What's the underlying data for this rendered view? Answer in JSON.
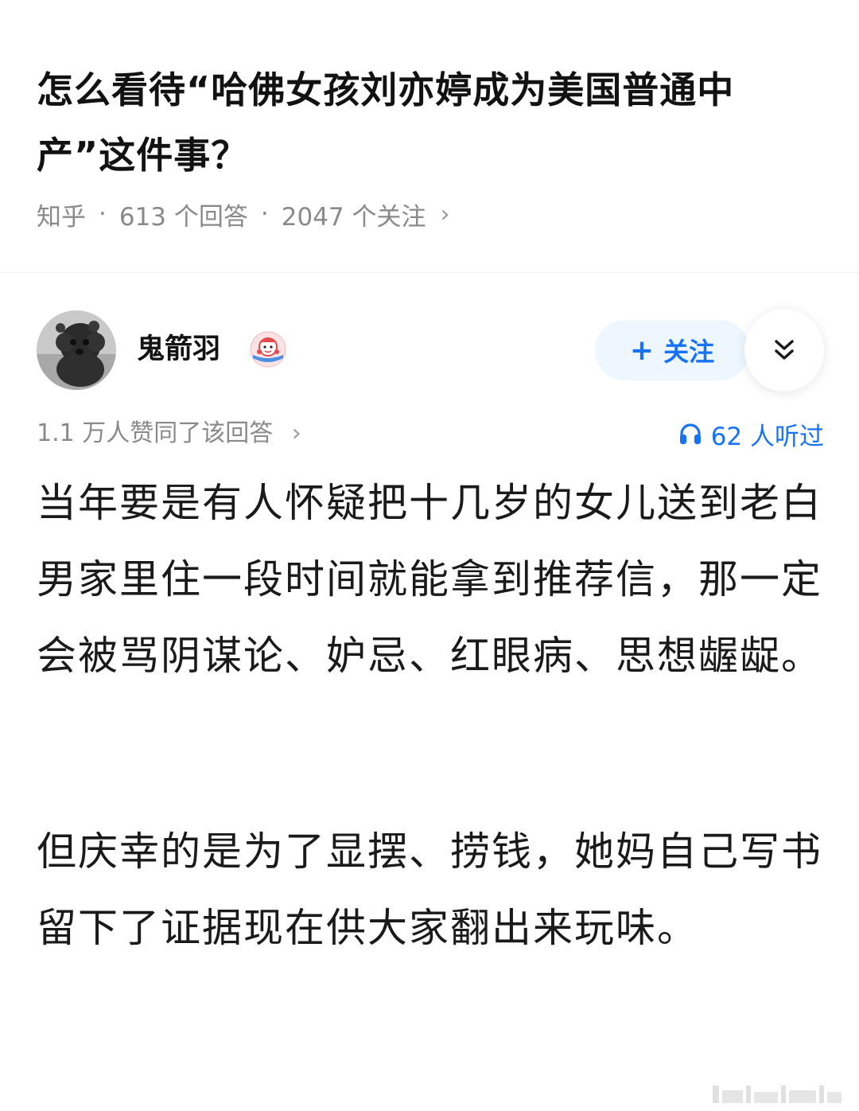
{
  "question": {
    "title": "怎么看待“哈佛女孩刘亦婷成为美国普通中产”这件事？",
    "source": "知乎",
    "separator": "·",
    "answers_count": "613 个回答",
    "followers_count": "2047 个关注",
    "chevron": "›"
  },
  "author": {
    "name": "鬼箭羽",
    "follow_plus": "+",
    "follow_label": "关注",
    "avatar_icon": "dog-avatar-icon",
    "badge_icon": "red-mascot-badge-icon",
    "more_icon": "double-chevron-down-icon"
  },
  "answer": {
    "upvotes": "1.1 万人赞同了该回答",
    "upvotes_chevron": "›",
    "listened": "62 人听过",
    "listened_icon": "headphones-icon",
    "paragraphs": [
      "当年要是有人怀疑把十几岁的女儿送到老白男家里住一段时间就能拿到推荐信，那一定会被骂阴谋论、妒忌、红眼病、思想龌龊。",
      "但庆幸的是为了显摆、捞钱，她妈自己写书留下了证据现在供大家翻出来玩味。"
    ]
  },
  "colors": {
    "accent": "#1772f6",
    "follow_bg": "#eef6ff",
    "meta_gray": "#8a8a8a",
    "text": "#1a1a1a"
  }
}
